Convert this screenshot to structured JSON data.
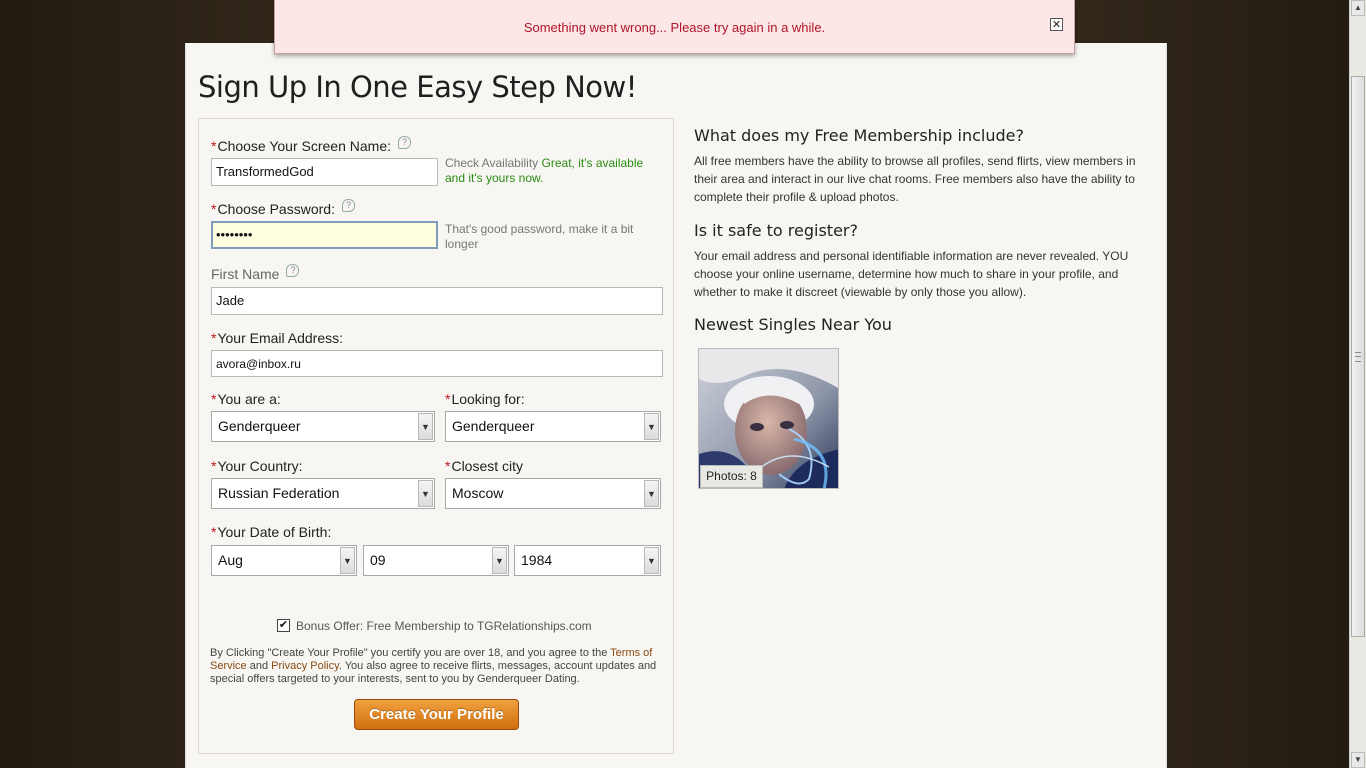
{
  "alert": {
    "message": "Something went wrong... Please try again in a while.",
    "close_symbol": "✕"
  },
  "page": {
    "title": "Sign Up In One Easy Step Now!"
  },
  "form": {
    "required_marker": "*",
    "help_symbol": "?",
    "screen_name": {
      "label": "Choose Your Screen Name:",
      "value": "TransformedGod",
      "check_label": "Check Availability",
      "status": "Great, it's available and it's yours now."
    },
    "password": {
      "label": "Choose Password:",
      "value": "••••••••",
      "hint": "That's good password, make it a bit longer"
    },
    "first_name": {
      "label": "First Name",
      "value": "Jade"
    },
    "email": {
      "label": "Your Email Address:",
      "value": "avora@inbox.ru"
    },
    "you_are": {
      "label": "You are a:",
      "selected": "Genderqueer"
    },
    "looking_for": {
      "label": "Looking for:",
      "selected": "Genderqueer"
    },
    "country": {
      "label": "Your Country:",
      "selected": "Russian Federation"
    },
    "city": {
      "label": "Closest city",
      "selected": "Moscow"
    },
    "dob": {
      "label": "Your Date of Birth:",
      "month": "Aug",
      "day": "09",
      "year": "1984"
    },
    "bonus": {
      "checked": true,
      "check_symbol": "✔",
      "label": "Bonus Offer: Free Membership to TGRelationships.com"
    },
    "legal": {
      "part1": "By Clicking \"Create Your Profile\" you certify you are over 18, and you agree to the ",
      "terms_link": "Terms of Service",
      "and": " and ",
      "privacy_link": "Privacy Policy",
      "part2": ". You also agree to receive flirts, messages, account updates and special offers targeted to your interests, sent to you by Genderqueer Dating."
    },
    "submit_label": "Create Your Profile",
    "select_arrow": "▼"
  },
  "sidebar": {
    "membership_heading": "What does my Free Membership include?",
    "membership_text": "All free members have the ability to browse all profiles, send flirts, view members in their area and interact in our live chat rooms. Free members also have the ability to complete their profile & upload photos.",
    "safe_heading": "Is it safe to register?",
    "safe_text": "Your email address and personal identifiable information are never revealed. YOU choose your online username, determine how much to share in your profile, and whether to make it discreet (viewable by only those you allow).",
    "singles_heading": "Newest Singles Near You",
    "singles": [
      {
        "photos_label": "Photos: 8"
      }
    ]
  },
  "scrollbar": {
    "up_symbol": "▲",
    "down_symbol": "▼"
  },
  "colors": {
    "alert_text": "#b0152a",
    "required": "#c0151b",
    "available": "#2a8c13",
    "cta": "#d0700f",
    "link": "#8b4a12"
  }
}
